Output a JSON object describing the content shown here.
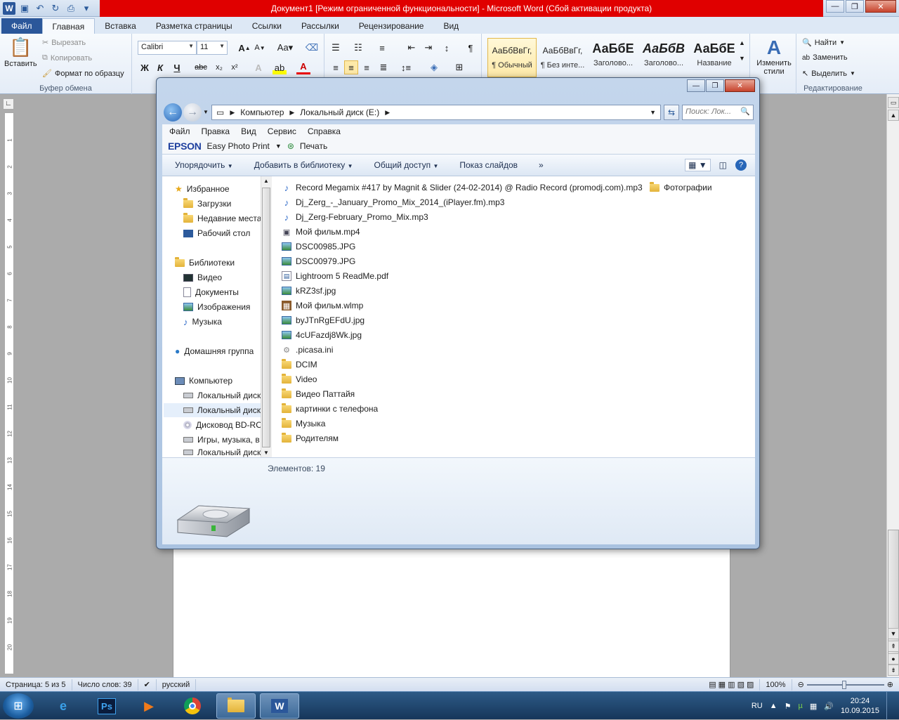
{
  "word": {
    "title": "Документ1 [Режим ограниченной функциональности]  -  Microsoft Word (Сбой активации продукта)",
    "tabs": [
      "Файл",
      "Главная",
      "Вставка",
      "Разметка страницы",
      "Ссылки",
      "Рассылки",
      "Рецензирование",
      "Вид"
    ],
    "clipboard": {
      "paste": "Вставить",
      "cut": "Вырезать",
      "copy": "Копировать",
      "format_painter": "Формат по образцу",
      "group": "Буфер обмена"
    },
    "font": {
      "name": "Calibri",
      "size": "11"
    },
    "styles": [
      {
        "sample": "АаБбВвГг,",
        "name": "¶ Обычный"
      },
      {
        "sample": "АаБбВвГг,",
        "name": "¶ Без инте..."
      },
      {
        "sample": "АаБбЕ",
        "name": "Заголово..."
      },
      {
        "sample": "АаБбВ",
        "name": "Заголово..."
      },
      {
        "sample": "АаБбЕ",
        "name": "Название"
      }
    ],
    "change_styles": "Изменить стили",
    "editing": {
      "find": "Найти",
      "replace": "Заменить",
      "select": "Выделить",
      "group": "Редактирование"
    },
    "status": {
      "page": "Страница: 5 из 5",
      "words": "Число слов: 39",
      "lang": "русский",
      "zoom": "100%"
    }
  },
  "explorer": {
    "breadcrumb": [
      "Компьютер",
      "Локальный диск (E:)"
    ],
    "search_placeholder": "Поиск: Лок...",
    "menu": [
      "Файл",
      "Правка",
      "Вид",
      "Сервис",
      "Справка"
    ],
    "epson": {
      "logo": "EPSON",
      "app": "Easy Photo Print",
      "print": "Печать"
    },
    "toolbar": [
      "Упорядочить",
      "Добавить в библиотеку",
      "Общий доступ",
      "Показ слайдов"
    ],
    "nav": {
      "favorites": "Избранное",
      "fav_items": [
        "Загрузки",
        "Недавние места",
        "Рабочий стол"
      ],
      "libraries": "Библиотеки",
      "lib_items": [
        "Видео",
        "Документы",
        "Изображения",
        "Музыка"
      ],
      "homegroup": "Домашняя группа",
      "computer": "Компьютер",
      "comp_items": [
        "Локальный диск",
        "Локальный диск",
        "Дисковод BD-RO",
        "Игры, музыка, в",
        "Локальный диск"
      ]
    },
    "files": [
      {
        "name": "Record Megamix #417 by Magnit & Slider (24-02-2014) @ Radio Record (promodj.com).mp3",
        "type": "music"
      },
      {
        "name": "Dj_Zerg_-_January_Promo_Mix_2014_(iPlayer.fm).mp3",
        "type": "music"
      },
      {
        "name": "Dj_Zerg-February_Promo_Mix.mp3",
        "type": "music"
      },
      {
        "name": "Мой фильм.mp4",
        "type": "video"
      },
      {
        "name": "DSC00985.JPG",
        "type": "image"
      },
      {
        "name": "DSC00979.JPG",
        "type": "image"
      },
      {
        "name": "Lightroom 5 ReadMe.pdf",
        "type": "doc"
      },
      {
        "name": "kRZ3sf.jpg",
        "type": "image"
      },
      {
        "name": "Мой фильм.wlmp",
        "type": "film"
      },
      {
        "name": "byJTnRgEFdU.jpg",
        "type": "image"
      },
      {
        "name": "4cUFazdj8Wk.jpg",
        "type": "image"
      },
      {
        "name": ".picasa.ini",
        "type": "ini"
      },
      {
        "name": "DCIM",
        "type": "folder"
      },
      {
        "name": "Video",
        "type": "folder"
      },
      {
        "name": "Видео Паттайя",
        "type": "folder"
      },
      {
        "name": "картинки с  телефона",
        "type": "folder"
      },
      {
        "name": "Музыка",
        "type": "folder"
      },
      {
        "name": "Родителям",
        "type": "folder"
      }
    ],
    "folder_right": "Фотографии",
    "count": "Элементов: 19"
  },
  "taskbar": {
    "lang": "RU",
    "time": "20:24",
    "date": "10.09.2015"
  }
}
